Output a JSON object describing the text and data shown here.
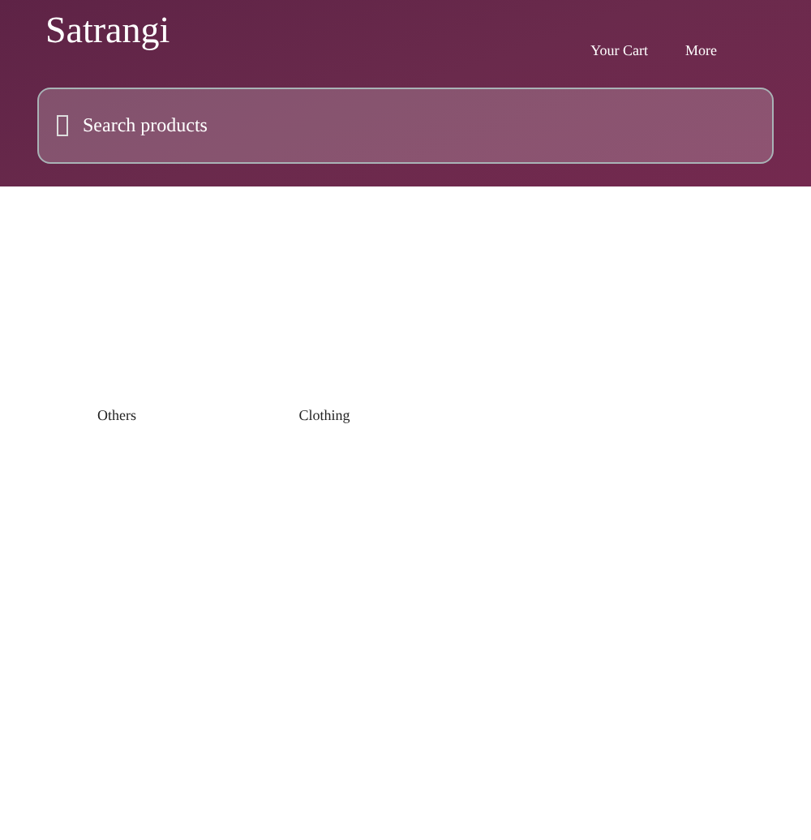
{
  "header": {
    "brand": "Satrangi",
    "nav": [
      {
        "label": "Your Cart"
      },
      {
        "label": "More"
      }
    ],
    "search": {
      "placeholder": "Search products"
    }
  },
  "categories": [
    {
      "label": "Others"
    },
    {
      "label": "Clothing"
    }
  ]
}
